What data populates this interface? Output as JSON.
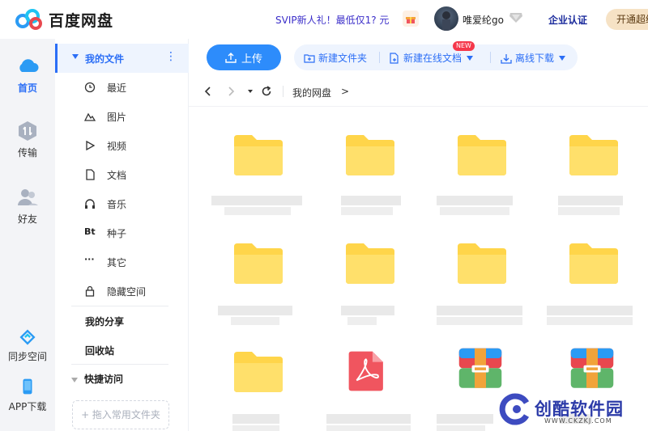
{
  "app": {
    "name": "百度网盘"
  },
  "header": {
    "promo": "SVIP新人礼！最低仅1? 元",
    "username": "唯爱纶go",
    "enterprise_label": "企业认证",
    "open_vip_label": "开通超级"
  },
  "rail": {
    "items": [
      {
        "label": "首页",
        "icon": "cloud-icon"
      },
      {
        "label": "传输",
        "icon": "transfer-icon"
      },
      {
        "label": "好友",
        "icon": "friends-icon"
      },
      {
        "label": "同步空间",
        "icon": "sync-icon"
      },
      {
        "label": "APP下载",
        "icon": "phone-icon"
      }
    ]
  },
  "sidebar": {
    "section_label": "我的文件",
    "more_glyph": "⋮",
    "items": [
      {
        "label": "最近",
        "icon": "clock-icon"
      },
      {
        "label": "图片",
        "icon": "mountain-icon"
      },
      {
        "label": "视频",
        "icon": "play-icon"
      },
      {
        "label": "文档",
        "icon": "document-icon"
      },
      {
        "label": "音乐",
        "icon": "headphones-icon"
      },
      {
        "label": "种子",
        "icon": "bt-icon",
        "glyph": "Bt"
      },
      {
        "label": "其它",
        "icon": "dots-icon",
        "glyph": "···"
      },
      {
        "label": "隐藏空间",
        "icon": "lock-icon"
      }
    ],
    "my_share": "我的分享",
    "recycle_bin": "回收站",
    "quick_access": "快捷访问",
    "drop_zone": "+ 拖入常用文件夹"
  },
  "toolbar": {
    "upload_label": "上传",
    "new_folder_label": "新建文件夹",
    "new_online_doc_label": "新建在线文档",
    "new_badge": "NEW",
    "offline_download_label": "离线下载"
  },
  "breadcrumb": {
    "current": "我的网盘",
    "separator": ">"
  },
  "files": [
    {
      "type": "folder"
    },
    {
      "type": "folder"
    },
    {
      "type": "folder"
    },
    {
      "type": "folder"
    },
    {
      "type": "folder"
    },
    {
      "type": "folder"
    },
    {
      "type": "folder"
    },
    {
      "type": "folder"
    },
    {
      "type": "folder"
    },
    {
      "type": "pdf"
    },
    {
      "type": "archive"
    },
    {
      "type": "archive"
    }
  ],
  "watermark": {
    "text": "创酷软件园",
    "url": "WWW.CKZKJ.COM"
  },
  "colors": {
    "accent": "#2b6ef6",
    "upload": "#2d8cfb",
    "folder": "#ffd54a",
    "pdf": "#f0555f",
    "archive_top": "#e8474e",
    "archive_bottom": "#5fb56a",
    "archive_strap": "#f1a33a"
  }
}
